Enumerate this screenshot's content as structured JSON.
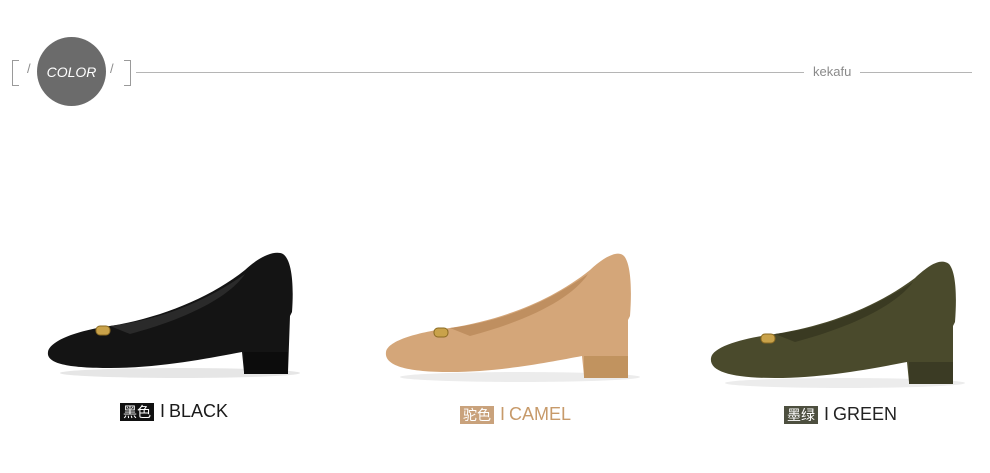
{
  "header": {
    "badge_text": "COLOR",
    "brand": "kekafu"
  },
  "products": [
    {
      "color_cn": "黑色",
      "color_en": "BLACK",
      "shoe_color": "#1a1a1a",
      "tag_color": "#111111"
    },
    {
      "color_cn": "驼色",
      "color_en": "CAMEL",
      "shoe_color": "#d4a679",
      "tag_color": "#c9a27c"
    },
    {
      "color_cn": "墨绿",
      "color_en": "GREEN",
      "shoe_color": "#4a4a2c",
      "tag_color": "#4d4f3f"
    }
  ],
  "separator": "I"
}
